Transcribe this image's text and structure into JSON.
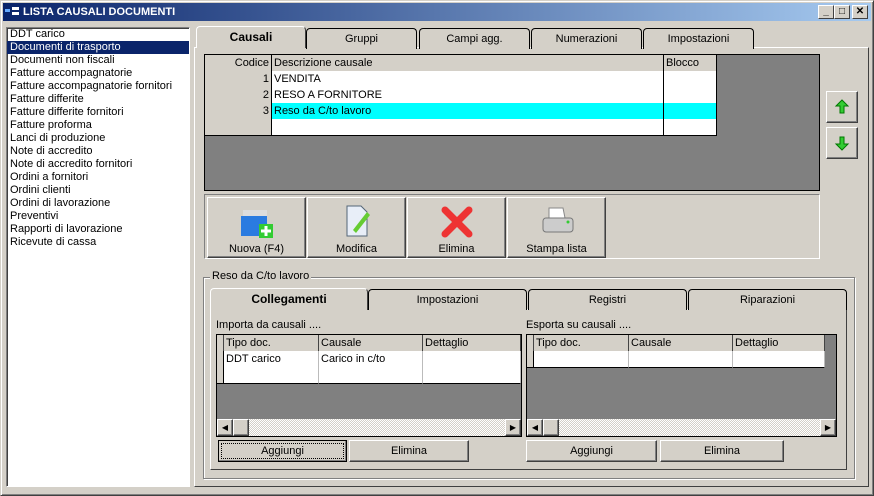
{
  "window": {
    "title": "LISTA CAUSALI DOCUMENTI",
    "min": "_",
    "max": "□",
    "close": "✕"
  },
  "sidebar": {
    "items": [
      "DDT carico",
      "Documenti di trasporto",
      "Documenti non fiscali",
      "Fatture accompagnatorie",
      "Fatture accompagnatorie fornitori",
      "Fatture differite",
      "Fatture differite fornitori",
      "Fatture proforma",
      "Lanci di produzione",
      "Note di accredito",
      "Note di accredito fornitori",
      "Ordini a fornitori",
      "Ordini clienti",
      "Ordini di lavorazione",
      "Preventivi",
      "Rapporti di lavorazione",
      "Ricevute di cassa"
    ],
    "selected": "Documenti di trasporto"
  },
  "tabs": [
    "Causali",
    "Gruppi",
    "Campi agg.",
    "Numerazioni",
    "Impostazioni"
  ],
  "grid": {
    "headers": [
      "Codice",
      "Descrizione causale",
      "Blocco"
    ],
    "rows": [
      {
        "code": "1",
        "desc": "VENDITA",
        "blocco": ""
      },
      {
        "code": "2",
        "desc": "RESO A FORNITORE",
        "blocco": ""
      },
      {
        "code": "3",
        "desc": "Reso da C/to lavoro",
        "blocco": ""
      }
    ],
    "selected_color": "#00ffff"
  },
  "toolbar": {
    "new": "Nuova (F4)",
    "edit": "Modifica",
    "delete": "Elimina",
    "print": "Stampa lista"
  },
  "detail": {
    "group_label": "Reso da C/to lavoro",
    "tabs": [
      "Collegamenti",
      "Impostazioni",
      "Registri",
      "Riparazioni"
    ],
    "import": {
      "label": "Importa da causali ....",
      "headers": [
        "Tipo doc.",
        "Causale",
        "Dettaglio"
      ],
      "rows": [
        [
          "DDT carico",
          "Carico in c/to",
          ""
        ]
      ],
      "add": "Aggiungi",
      "delete": "Elimina"
    },
    "export": {
      "label": "Esporta su causali ....",
      "headers": [
        "Tipo doc.",
        "Causale",
        "Dettaglio"
      ],
      "add": "Aggiungi",
      "delete": "Elimina"
    }
  }
}
